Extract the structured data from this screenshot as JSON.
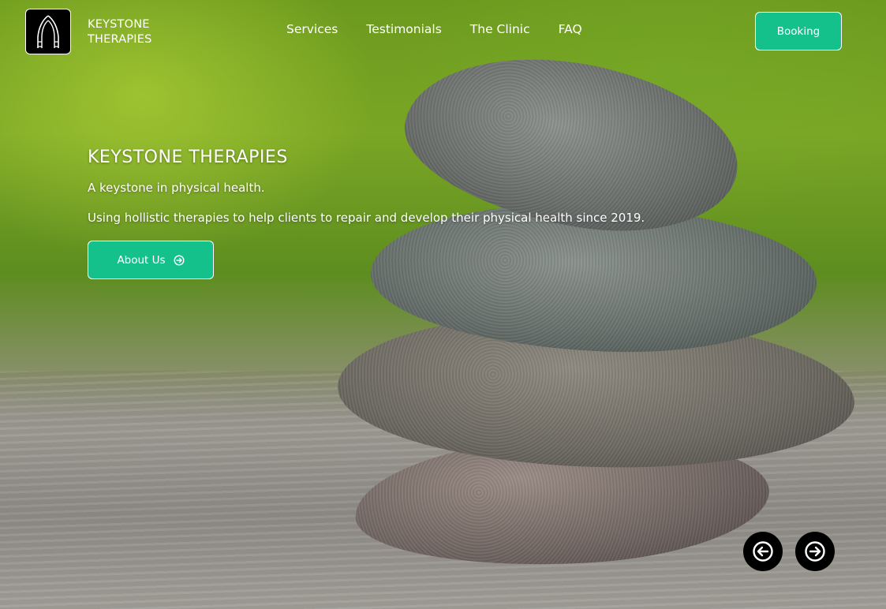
{
  "brand": {
    "line1": "KEYSTONE",
    "line2": "THERAPIES",
    "logo_icon": "arch-hands-icon"
  },
  "nav": {
    "items": [
      "Services",
      "Testimonials",
      "The Clinic",
      "FAQ"
    ]
  },
  "header": {
    "booking_label": "Booking"
  },
  "hero": {
    "title": "KEYSTONE THERAPIES",
    "tagline": "A keystone in physical health.",
    "description": "Using hollistic therapies to help clients to repair and develop their physical health since 2019.",
    "cta_label": "About Us",
    "cta_icon": "arrow-right-circle-icon"
  },
  "slider": {
    "prev_icon": "arrow-left-circle-icon",
    "next_icon": "arrow-right-circle-icon"
  },
  "colors": {
    "accent": "#14c18a",
    "text": "#ffffff",
    "dark": "#000000"
  }
}
